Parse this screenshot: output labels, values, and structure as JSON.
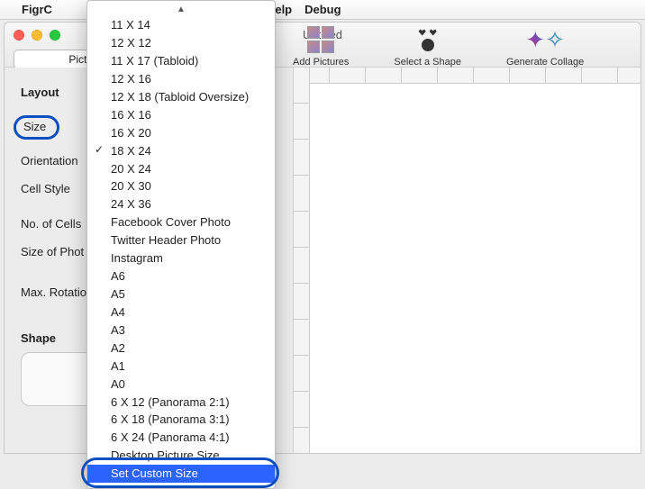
{
  "menubar": {
    "app": "FigrC",
    "help": "Help",
    "debug": "Debug"
  },
  "window": {
    "title": "Untitled",
    "segment_label": "Picture"
  },
  "toolbar": {
    "add_pictures": "Add Pictures",
    "select_shape": "Select a Shape",
    "generate": "Generate Collage"
  },
  "sidebar": {
    "layout_header": "Layout",
    "size": "Size",
    "orientation": "Orientation",
    "cell_style": "Cell Style",
    "num_cells": "No. of Cells",
    "size_photo": "Size of Phot",
    "max_rotation": "Max. Rotatio",
    "shape_header": "Shape"
  },
  "size_menu": {
    "items": [
      "11 X 14",
      "12 X 12",
      "11 X 17 (Tabloid)",
      "12 X 16",
      "12 X 18 (Tabloid Oversize)",
      "16 X 16",
      "16 X 20",
      "18 X 24",
      "20 X 24",
      "20 X 30",
      "24 X 36",
      "Facebook Cover Photo",
      "Twitter Header Photo",
      "Instagram",
      "A6",
      "A5",
      "A4",
      "A3",
      "A2",
      "A1",
      "A0",
      "6 X 12 (Panorama 2:1)",
      "6 X 18 (Panorama 3:1)",
      "6 X 24 (Panorama 4:1)",
      "Desktop Picture Size",
      "Set Custom Size"
    ],
    "checked_index": 7,
    "highlighted_index": 25
  }
}
